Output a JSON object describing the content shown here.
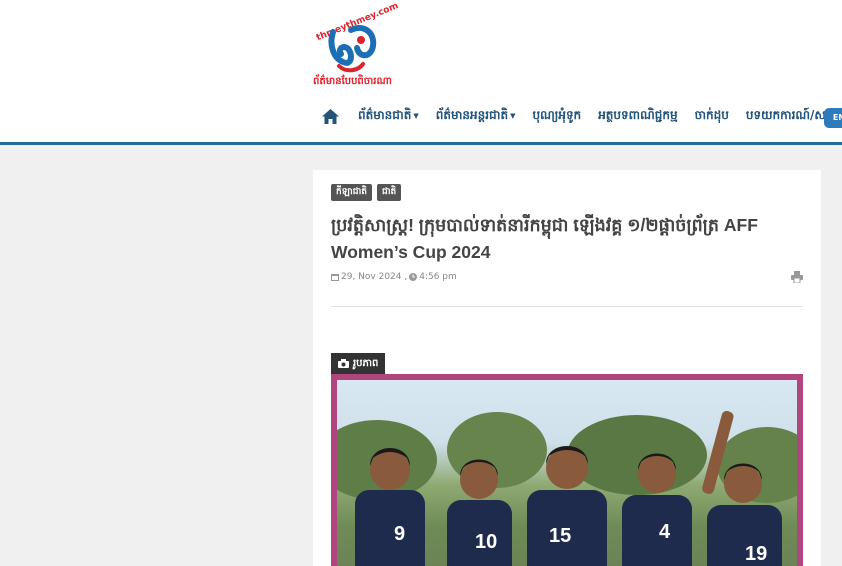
{
  "logo": {
    "url_text": "thmeythmey.com",
    "tagline": "ព័ត៌មានបែបពិចារណា"
  },
  "nav": {
    "items": [
      {
        "label": "ព័ត៌មានជាតិ",
        "dropdown": true
      },
      {
        "label": "ព័ត៌មានអន្តរជាតិ",
        "dropdown": true
      },
      {
        "label": "បុណ្យអុំទូក",
        "dropdown": false
      },
      {
        "label": "អត្ថបទពាណិជ្ជកម្ម",
        "dropdown": false
      },
      {
        "label": "ចាក់ដុប",
        "dropdown": false
      },
      {
        "label": "បទយកការណ៍/សម្ភាស",
        "dropdown": false
      }
    ],
    "pill_label": "EN"
  },
  "article": {
    "tags": [
      "កីឡាជាតិ",
      "ជាតិ"
    ],
    "title": "ប្រវត្តិសាស្ត្រ! ក្រុមបាល់ទាត់នារីកម្ពុជា ឡើងវគ្គ ១/២ផ្តាច់ព្រ័ត្រ AFF Women’s Cup 2024",
    "date": "29, Nov 2024 ,",
    "time": "4:56 pm",
    "photo_label": "រូបភាព",
    "jersey_numbers": [
      "9",
      "10",
      "15",
      "4",
      "19"
    ]
  },
  "colors": {
    "nav_text": "#23547a",
    "nav_border": "#2a6b95",
    "logo_red": "#d9232d",
    "logo_blue": "#1c6fb4",
    "photo_frame": "#b0467e",
    "jersey": "#1f2b4d"
  },
  "icons": [
    "home-icon",
    "calendar-icon",
    "clock-icon",
    "print-icon",
    "camera-icon"
  ]
}
